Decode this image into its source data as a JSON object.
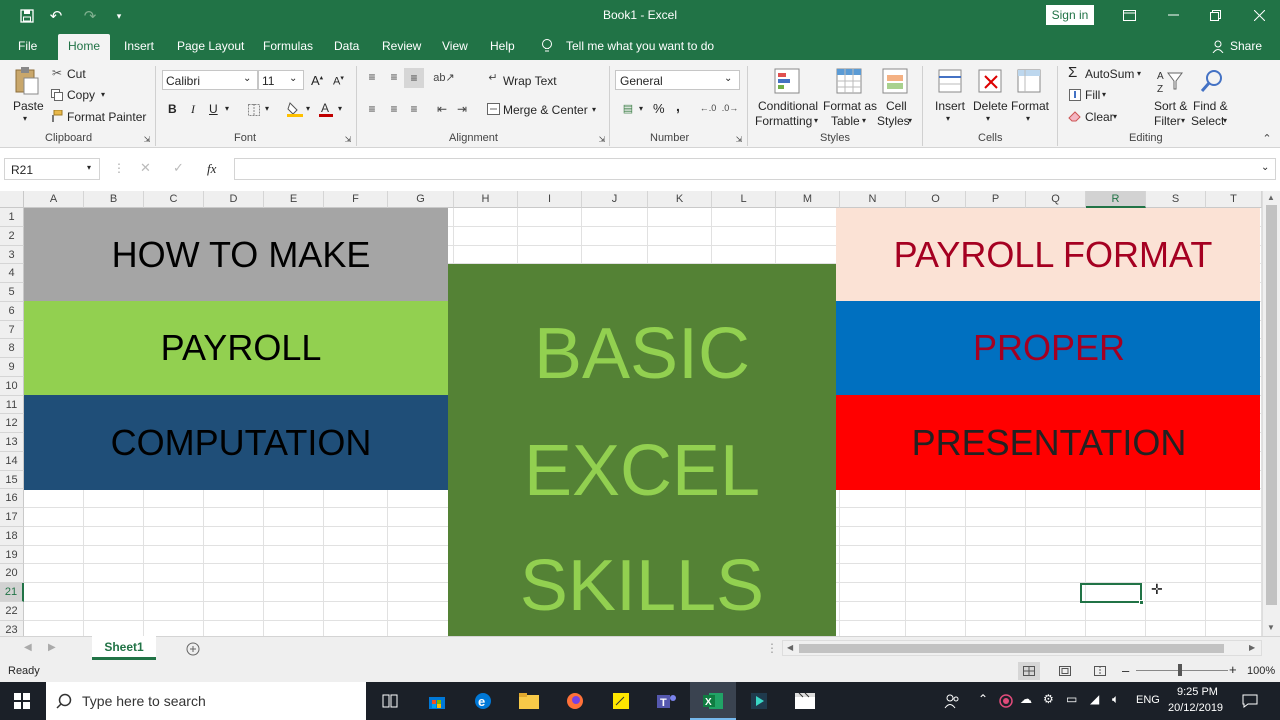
{
  "window": {
    "title": "Book1  -  Excel",
    "sign_in": "Sign in"
  },
  "tabs": [
    "File",
    "Home",
    "Insert",
    "Page Layout",
    "Formulas",
    "Data",
    "Review",
    "View",
    "Help"
  ],
  "tell_me": "Tell me what you want to do",
  "share": "Share",
  "ribbon": {
    "clipboard": {
      "paste": "Paste",
      "cut": "Cut",
      "copy": "Copy",
      "format_painter": "Format Painter",
      "label": "Clipboard"
    },
    "font": {
      "name": "Calibri",
      "size": "11",
      "bold": "B",
      "italic": "I",
      "underline": "U",
      "label": "Font"
    },
    "alignment": {
      "wrap_text": "Wrap Text",
      "merge_center": "Merge & Center",
      "label": "Alignment"
    },
    "number": {
      "format": "General",
      "percent": "%",
      "comma": ",",
      "label": "Number"
    },
    "styles": {
      "conditional_1": "Conditional",
      "conditional_2": "Formatting",
      "format_table_1": "Format as",
      "format_table_2": "Table",
      "cell_styles_1": "Cell",
      "cell_styles_2": "Styles",
      "label": "Styles"
    },
    "cells": {
      "insert": "Insert",
      "delete": "Delete",
      "format": "Format",
      "label": "Cells"
    },
    "editing": {
      "autosum": "AutoSum",
      "fill": "Fill",
      "clear": "Clear",
      "sort_1": "Sort &",
      "sort_2": "Filter",
      "find_1": "Find &",
      "find_2": "Select",
      "label": "Editing"
    }
  },
  "formula_bar": {
    "name_box": "R21",
    "fx": "fx",
    "value": ""
  },
  "columns": [
    "A",
    "B",
    "C",
    "D",
    "E",
    "F",
    "G",
    "H",
    "I",
    "J",
    "K",
    "L",
    "M",
    "N",
    "O",
    "P",
    "Q",
    "R",
    "S",
    "T"
  ],
  "rows": [
    "1",
    "2",
    "3",
    "4",
    "5",
    "6",
    "7",
    "8",
    "9",
    "10",
    "11",
    "12",
    "13",
    "14",
    "15",
    "16",
    "17",
    "18",
    "19",
    "20",
    "21",
    "22",
    "23"
  ],
  "content": {
    "left_1": "HOW TO MAKE",
    "left_2": "PAYROLL",
    "left_3": "COMPUTATION",
    "center_1": "BASIC",
    "center_2": "EXCEL",
    "center_3": "SKILLS",
    "right_1": "PAYROLL FORMAT",
    "right_2": "PROPER",
    "right_3": "PRESENTATION"
  },
  "colors": {
    "excel_green": "#217346",
    "gray_band": "#a5a5a5",
    "light_green_band": "#92d050",
    "dark_blue_band": "#1f4e78",
    "center_green": "#548235",
    "center_text": "#92d050",
    "peach_band": "#fbe2d5",
    "blue_band": "#0070c0",
    "red_band": "#ff0000",
    "dark_red_text": "#a50021"
  },
  "sheet_tab": "Sheet1",
  "status": {
    "ready": "Ready",
    "zoom": "100%"
  },
  "taskbar": {
    "search": "Type here to search",
    "time": "9:25 PM",
    "date": "20/12/2019",
    "lang": "ENG"
  }
}
